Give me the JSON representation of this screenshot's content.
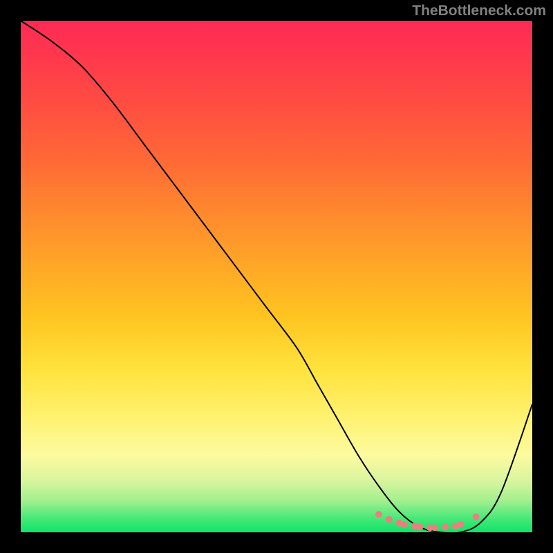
{
  "watermark": "TheBottleneck.com",
  "chart_data": {
    "type": "line",
    "title": "",
    "xlabel": "",
    "ylabel": "",
    "xlim": [
      0,
      100
    ],
    "ylim": [
      0,
      100
    ],
    "series": [
      {
        "name": "bottleneck-curve",
        "x": [
          0,
          6,
          12,
          18,
          24,
          30,
          36,
          42,
          48,
          54,
          58,
          62,
          66,
          70,
          74,
          78,
          82,
          86,
          90,
          94,
          100
        ],
        "y": [
          100,
          96,
          91,
          84,
          76,
          68,
          60,
          52,
          44,
          36,
          29,
          22,
          15,
          9,
          4,
          1,
          0,
          0,
          2,
          8,
          25
        ]
      }
    ],
    "markers": {
      "name": "valley-markers",
      "color": "#e88080",
      "x": [
        70,
        72,
        74,
        75,
        77,
        78,
        80,
        81,
        83,
        85,
        86,
        89
      ],
      "y": [
        3.5,
        2.5,
        1.8,
        1.5,
        1.2,
        1.0,
        0.9,
        0.9,
        1.0,
        1.2,
        1.5,
        3.0
      ]
    },
    "gradient_stops": [
      {
        "pos": 0,
        "color": "#ff2a55"
      },
      {
        "pos": 50,
        "color": "#ffc520"
      },
      {
        "pos": 80,
        "color": "#fdfaa0"
      },
      {
        "pos": 100,
        "color": "#0be566"
      }
    ]
  }
}
